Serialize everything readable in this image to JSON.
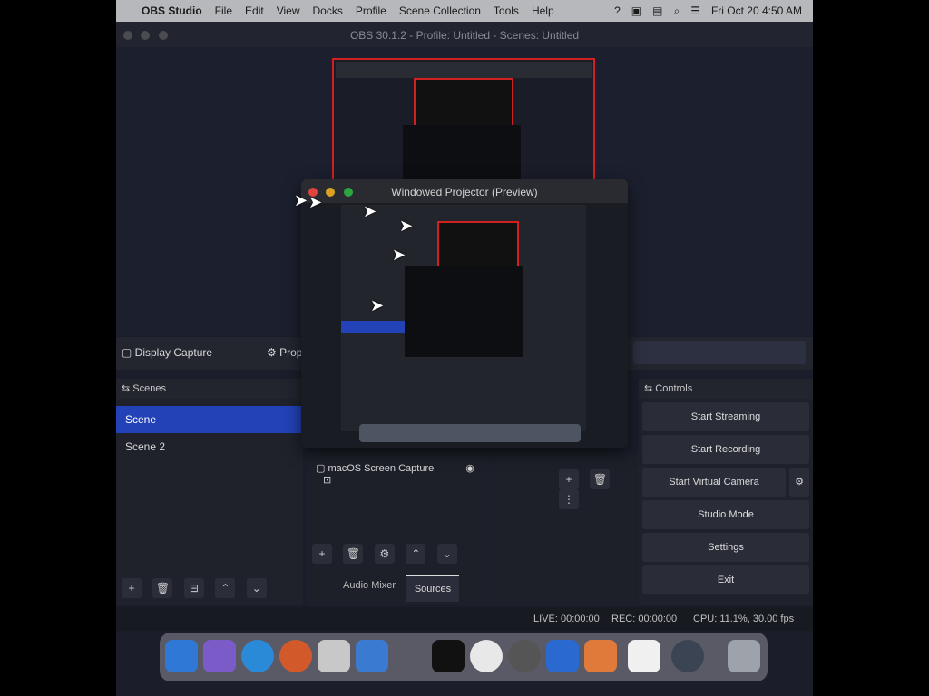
{
  "menubar": {
    "app_name": "OBS Studio",
    "items": [
      "File",
      "Edit",
      "View",
      "Docks",
      "Profile",
      "Scene Collection",
      "Tools",
      "Help"
    ],
    "clock": "Fri Oct 20  4:50 AM"
  },
  "window": {
    "title": "OBS 30.1.2 - Profile: Untitled - Scenes: Untitled"
  },
  "projector": {
    "title": "Windowed Projector (Preview)"
  },
  "source_bar": {
    "source_name": "Display Capture",
    "properties_label": "Prop"
  },
  "scenes": {
    "header": "Scenes",
    "items": [
      "Scene",
      "Scene 2"
    ],
    "selected_index": 0
  },
  "sources": {
    "item_label": "macOS Screen Capture"
  },
  "bottom_tabs": {
    "audio_mixer": "Audio Mixer",
    "sources": "Sources"
  },
  "controls": {
    "header": "Controls",
    "start_streaming": "Start Streaming",
    "start_recording": "Start Recording",
    "start_virtual_camera": "Start Virtual Camera",
    "studio_mode": "Studio Mode",
    "settings": "Settings",
    "exit": "Exit"
  },
  "status": {
    "live": "LIVE: 00:00:00",
    "rec": "REC: 00:00:00",
    "cpu": "CPU: 11.1%, 30.00 fps"
  },
  "colors": {
    "accent": "#2342b8",
    "preview_border": "#d02020"
  }
}
